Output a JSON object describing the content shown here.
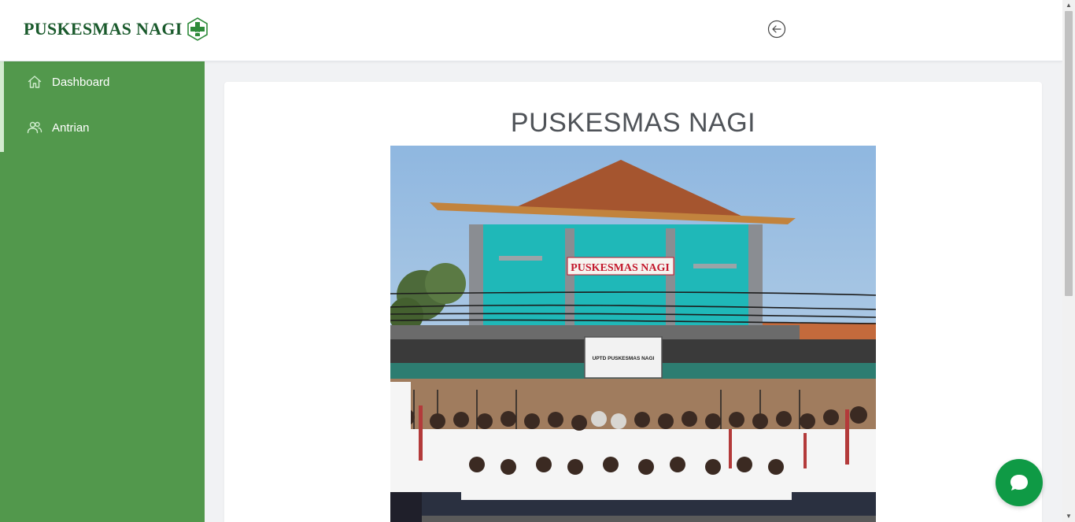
{
  "header": {
    "brand_name": "PUSKESMAS NAGI",
    "brand_logo_icon": "medical-cross-logo-icon",
    "back_icon": "arrow-left-circle-icon"
  },
  "sidebar": {
    "items": [
      {
        "label": "Dashboard",
        "icon": "home-icon"
      },
      {
        "label": "Antrian",
        "icon": "users-icon"
      }
    ]
  },
  "main": {
    "title": "PUSKESMAS NAGI",
    "photo": {
      "building_sign": "PUSKESMAS NAGI",
      "plaque_line1": "UPTD PUSKESMAS NAGI"
    }
  },
  "chat": {
    "icon": "chat-bubble-icon"
  },
  "colors": {
    "sidebar_bg": "#52984c",
    "brand_text": "#1a5a2c",
    "chat_button": "#0f9a45",
    "building_wall": "#1fb8b8"
  }
}
